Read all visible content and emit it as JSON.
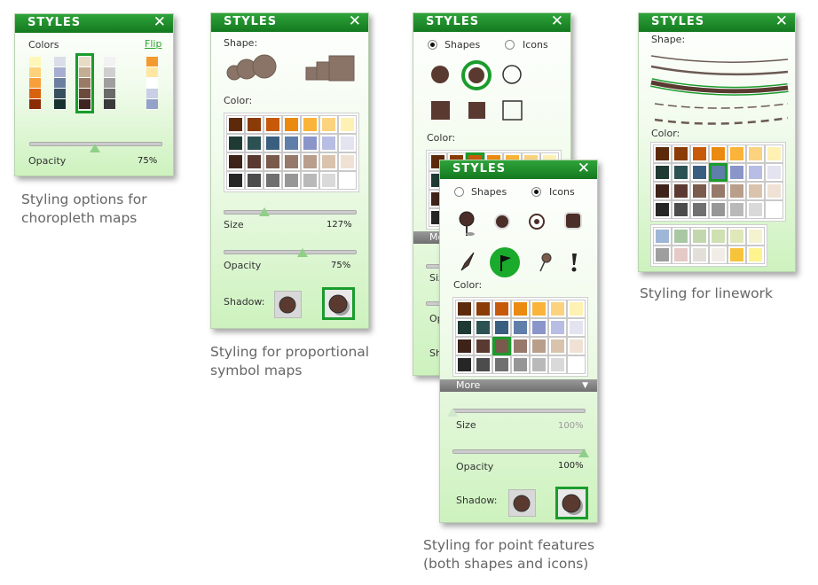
{
  "common": {
    "title": "STYLES",
    "close": "✕"
  },
  "p1": {
    "colors_label": "Colors",
    "flip_label": "Flip",
    "opacity_label": "Opacity",
    "opacity_value": "75%",
    "opacity_level": 0.5,
    "ramps": [
      [
        "#fff7b8",
        "#fdd27a",
        "#f7a03a",
        "#d9620c",
        "#8b2c04"
      ],
      [
        "#dbdde9",
        "#a7aed1",
        "#6b7fa0",
        "#375060",
        "#163330"
      ],
      [
        "#e9dcc7",
        "#c4ae93",
        "#9a7a64",
        "#6c4b3c",
        "#3e2523"
      ],
      [
        "#f2f2f2",
        "#cfcfcf",
        "#9f9f9f",
        "#6a6a6a",
        "#3a3a3a"
      ],
      [
        "#f39a2e",
        "#fde7a1",
        "#ffffff",
        "#c9cfe4",
        "#94a2c9"
      ]
    ]
  },
  "p2": {
    "shape_label": "Shape:",
    "color_label": "Color:",
    "size_label": "Size",
    "size_value": "127%",
    "size_level": 0.31,
    "opacity_label": "Opacity",
    "opacity_value": "75%",
    "opacity_level": 0.6,
    "shadow_label": "Shadow:"
  },
  "p3": {
    "shapes_label": "Shapes",
    "icons_label": "Icons",
    "color_label": "Color:",
    "more_label": "More",
    "size_label": "Size",
    "opacity_label": "Opacity",
    "shadow_label": "Shadow:"
  },
  "p4": {
    "shapes_label": "Shapes",
    "icons_label": "Icons",
    "color_label": "Color:",
    "more_label": "More",
    "size_label": "Size",
    "size_value": "100%",
    "size_level": 0.0,
    "opacity_label": "Opacity",
    "opacity_value": "100%",
    "opacity_level": 1.0,
    "shadow_label": "Shadow:"
  },
  "p5": {
    "shape_label": "Shape:",
    "color_label": "Color:"
  },
  "palette": [
    [
      "#5c2a0b",
      "#8a3b06",
      "#c65a0a",
      "#ea8a10",
      "#f9b439",
      "#fbd37e",
      "#fdf1b3"
    ],
    [
      "#1e3a33",
      "#2c5153",
      "#3a5e80",
      "#5f7eaa",
      "#8a96c9",
      "#b7bde3",
      "#e3e4ef"
    ],
    [
      "#3d2319",
      "#5a3a30",
      "#7a5a4c",
      "#96796a",
      "#b89e8b",
      "#d9c3ad",
      "#efe2d4"
    ],
    [
      "#262626",
      "#4c4c4c",
      "#707070",
      "#969696",
      "#b9b9b9",
      "#d9d9d9",
      "#ffffff"
    ]
  ],
  "linework_palette": [
    [
      "#9fb6d6",
      "#a9c7a3",
      "#c3d7ae",
      "#cfe0b3",
      "#dfe8b8",
      "#f5f2cf"
    ],
    [
      "#9e9e9e",
      "#e5c9c6",
      "#e3dfd8",
      "#f1ede6",
      "#f6c33a",
      "#fff38e"
    ]
  ],
  "captions": {
    "c1": [
      "Styling options for",
      "choropleth maps"
    ],
    "c2": [
      "Styling for proportional",
      "symbol maps"
    ],
    "c3": [
      "Styling for point features",
      "(both shapes and icons)"
    ],
    "c4": [
      "Styling for linework"
    ]
  }
}
